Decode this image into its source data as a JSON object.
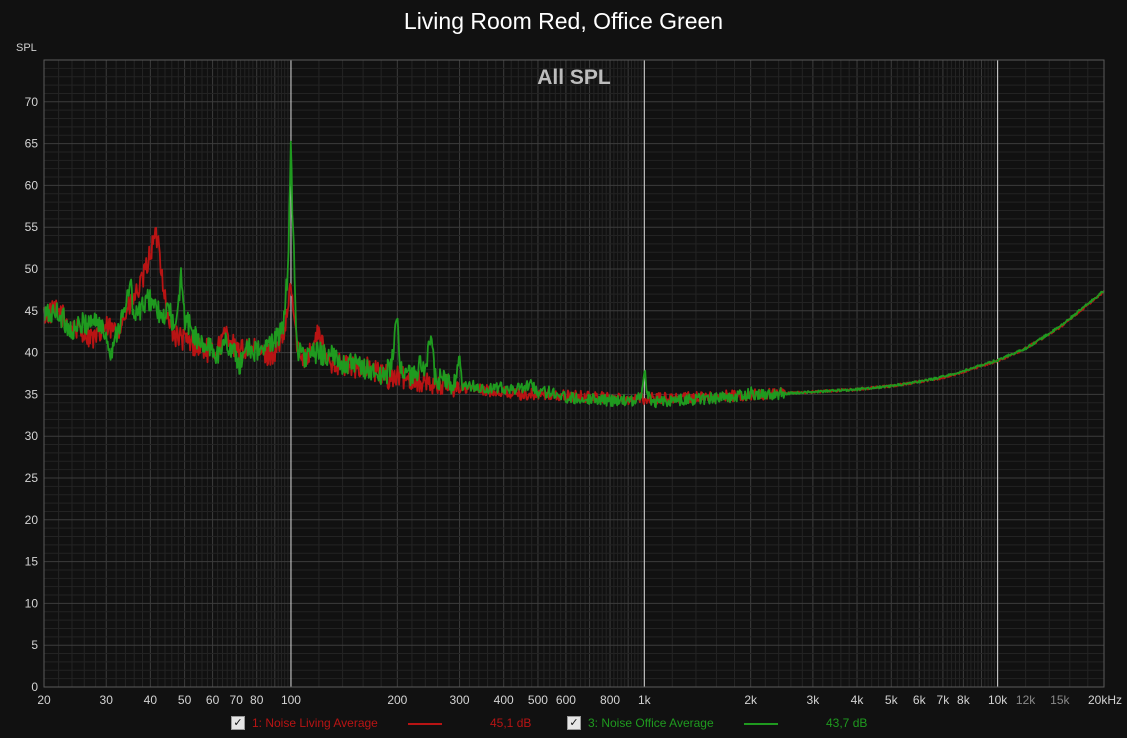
{
  "colors": {
    "background": "#111111",
    "grid": "#3a3a3a",
    "grid_major": "#d9d9d9",
    "living": "#b81414",
    "office": "#1f9a1f"
  },
  "chart_data": {
    "type": "line",
    "title": "Living Room Red, Office Green",
    "subtitle": "All SPL",
    "ylabel": "SPL",
    "xlabel": "",
    "x_scale": "log",
    "xlim": [
      20,
      20000
    ],
    "ylim": [
      0,
      75
    ],
    "grid": true,
    "legend_position": "bottom",
    "x_ticks": [
      {
        "v": 20,
        "label": "20"
      },
      {
        "v": 30,
        "label": "30"
      },
      {
        "v": 40,
        "label": "40"
      },
      {
        "v": 50,
        "label": "50"
      },
      {
        "v": 60,
        "label": "60"
      },
      {
        "v": 70,
        "label": "70"
      },
      {
        "v": 80,
        "label": "80"
      },
      {
        "v": 100,
        "label": "100"
      },
      {
        "v": 200,
        "label": "200"
      },
      {
        "v": 300,
        "label": "300"
      },
      {
        "v": 400,
        "label": "400"
      },
      {
        "v": 500,
        "label": "500"
      },
      {
        "v": 600,
        "label": "600"
      },
      {
        "v": 800,
        "label": "800"
      },
      {
        "v": 1000,
        "label": "1k"
      },
      {
        "v": 2000,
        "label": "2k"
      },
      {
        "v": 3000,
        "label": "3k"
      },
      {
        "v": 4000,
        "label": "4k"
      },
      {
        "v": 5000,
        "label": "5k"
      },
      {
        "v": 6000,
        "label": "6k"
      },
      {
        "v": 7000,
        "label": "7k"
      },
      {
        "v": 8000,
        "label": "8k"
      },
      {
        "v": 10000,
        "label": "10k"
      },
      {
        "v": 12000,
        "label": "12k"
      },
      {
        "v": 15000,
        "label": "15k"
      },
      {
        "v": 20000,
        "label": "20kHz"
      }
    ],
    "y_ticks": [
      0,
      5,
      10,
      15,
      20,
      25,
      30,
      35,
      40,
      45,
      50,
      55,
      60,
      65,
      70
    ],
    "series": [
      {
        "name": "1: Noise Living Average",
        "value_label": "45,1 dB",
        "color": "#b81414",
        "points": [
          [
            20,
            44.5
          ],
          [
            22,
            45.0
          ],
          [
            24,
            43.0
          ],
          [
            26,
            42.5
          ],
          [
            28,
            41.5
          ],
          [
            30,
            43.0
          ],
          [
            32,
            42.5
          ],
          [
            34,
            44.5
          ],
          [
            36,
            46.5
          ],
          [
            38,
            48.5
          ],
          [
            40,
            52.0
          ],
          [
            41,
            53.5
          ],
          [
            42,
            53.8
          ],
          [
            43,
            50.0
          ],
          [
            45,
            43.5
          ],
          [
            47,
            42.0
          ],
          [
            50,
            41.5
          ],
          [
            53,
            41.0
          ],
          [
            56,
            40.5
          ],
          [
            60,
            40.0
          ],
          [
            63,
            41.0
          ],
          [
            66,
            42.5
          ],
          [
            70,
            40.0
          ],
          [
            75,
            40.5
          ],
          [
            80,
            40.2
          ],
          [
            85,
            39.8
          ],
          [
            90,
            40.0
          ],
          [
            95,
            41.5
          ],
          [
            98,
            45.0
          ],
          [
            100,
            48.5
          ],
          [
            102,
            44.0
          ],
          [
            105,
            40.0
          ],
          [
            110,
            39.5
          ],
          [
            115,
            40.5
          ],
          [
            120,
            42.5
          ],
          [
            125,
            39.5
          ],
          [
            130,
            39.0
          ],
          [
            140,
            38.5
          ],
          [
            150,
            38.2
          ],
          [
            160,
            38.5
          ],
          [
            170,
            37.8
          ],
          [
            180,
            37.5
          ],
          [
            190,
            37.0
          ],
          [
            200,
            37.2
          ],
          [
            220,
            36.8
          ],
          [
            240,
            36.5
          ],
          [
            260,
            36.2
          ],
          [
            280,
            36.0
          ],
          [
            300,
            35.8
          ],
          [
            350,
            35.5
          ],
          [
            400,
            35.3
          ],
          [
            450,
            35.0
          ],
          [
            500,
            35.0
          ],
          [
            600,
            34.8
          ],
          [
            700,
            34.7
          ],
          [
            800,
            34.6
          ],
          [
            900,
            34.5
          ],
          [
            1000,
            34.5
          ],
          [
            1200,
            34.6
          ],
          [
            1500,
            34.7
          ],
          [
            2000,
            34.9
          ],
          [
            2500,
            35.1
          ],
          [
            3000,
            35.3
          ],
          [
            4000,
            35.6
          ],
          [
            5000,
            36.0
          ],
          [
            6000,
            36.5
          ],
          [
            7000,
            37.0
          ],
          [
            8000,
            37.7
          ],
          [
            10000,
            39.0
          ],
          [
            12000,
            40.5
          ],
          [
            15000,
            43.0
          ],
          [
            20000,
            47.3
          ]
        ]
      },
      {
        "name": "3: Noise Office Average",
        "value_label": "43,7 dB",
        "color": "#1f9a1f",
        "points": [
          [
            20,
            44.5
          ],
          [
            22,
            44.8
          ],
          [
            24,
            42.5
          ],
          [
            26,
            43.5
          ],
          [
            28,
            44.0
          ],
          [
            30,
            42.0
          ],
          [
            31,
            40.0
          ],
          [
            32,
            42.5
          ],
          [
            34,
            45.0
          ],
          [
            35,
            48.8
          ],
          [
            36,
            44.0
          ],
          [
            38,
            45.5
          ],
          [
            40,
            46.5
          ],
          [
            42,
            45.0
          ],
          [
            43,
            43.5
          ],
          [
            45,
            45.5
          ],
          [
            47,
            42.5
          ],
          [
            48,
            45.0
          ],
          [
            49,
            49.8
          ],
          [
            50,
            44.0
          ],
          [
            52,
            43.0
          ],
          [
            55,
            41.0
          ],
          [
            60,
            40.5
          ],
          [
            62,
            39.5
          ],
          [
            65,
            41.5
          ],
          [
            70,
            39.5
          ],
          [
            72,
            38.5
          ],
          [
            75,
            41.0
          ],
          [
            80,
            40.0
          ],
          [
            85,
            40.5
          ],
          [
            90,
            41.8
          ],
          [
            95,
            42.5
          ],
          [
            98,
            50.0
          ],
          [
            99,
            58.0
          ],
          [
            100,
            65.2
          ],
          [
            101,
            57.0
          ],
          [
            103,
            45.0
          ],
          [
            105,
            40.0
          ],
          [
            110,
            39.5
          ],
          [
            120,
            40.0
          ],
          [
            130,
            39.5
          ],
          [
            140,
            38.8
          ],
          [
            150,
            38.5
          ],
          [
            160,
            38.2
          ],
          [
            170,
            37.8
          ],
          [
            180,
            37.0
          ],
          [
            190,
            38.0
          ],
          [
            195,
            40.0
          ],
          [
            199,
            44.7
          ],
          [
            203,
            39.0
          ],
          [
            210,
            37.5
          ],
          [
            220,
            37.0
          ],
          [
            235,
            39.0
          ],
          [
            240,
            38.0
          ],
          [
            250,
            41.8
          ],
          [
            255,
            37.0
          ],
          [
            270,
            36.5
          ],
          [
            290,
            36.0
          ],
          [
            300,
            39.2
          ],
          [
            305,
            35.8
          ],
          [
            330,
            36.0
          ],
          [
            350,
            35.5
          ],
          [
            400,
            35.8
          ],
          [
            450,
            35.6
          ],
          [
            480,
            36.4
          ],
          [
            500,
            35.2
          ],
          [
            550,
            35.3
          ],
          [
            600,
            34.6
          ],
          [
            700,
            34.5
          ],
          [
            800,
            34.3
          ],
          [
            900,
            34.2
          ],
          [
            950,
            34.4
          ],
          [
            980,
            35.0
          ],
          [
            1000,
            38.3
          ],
          [
            1020,
            35.0
          ],
          [
            1050,
            34.2
          ],
          [
            1100,
            34.1
          ],
          [
            1200,
            34.3
          ],
          [
            1500,
            34.5
          ],
          [
            1800,
            34.8
          ],
          [
            1990,
            35.0
          ],
          [
            2000,
            35.8
          ],
          [
            2030,
            35.0
          ],
          [
            2500,
            35.1
          ],
          [
            3000,
            35.3
          ],
          [
            4000,
            35.6
          ],
          [
            5000,
            36.0
          ],
          [
            6000,
            36.5
          ],
          [
            7000,
            37.1
          ],
          [
            8000,
            37.8
          ],
          [
            10000,
            39.1
          ],
          [
            12000,
            40.5
          ],
          [
            15000,
            43.1
          ],
          [
            20000,
            47.4
          ]
        ]
      }
    ]
  },
  "legend": {
    "items": [
      {
        "name": "1: Noise Living Average",
        "value": "45,1 dB"
      },
      {
        "name": "3: Noise Office Average",
        "value": "43,7 dB"
      }
    ],
    "check_glyph": "✓"
  }
}
